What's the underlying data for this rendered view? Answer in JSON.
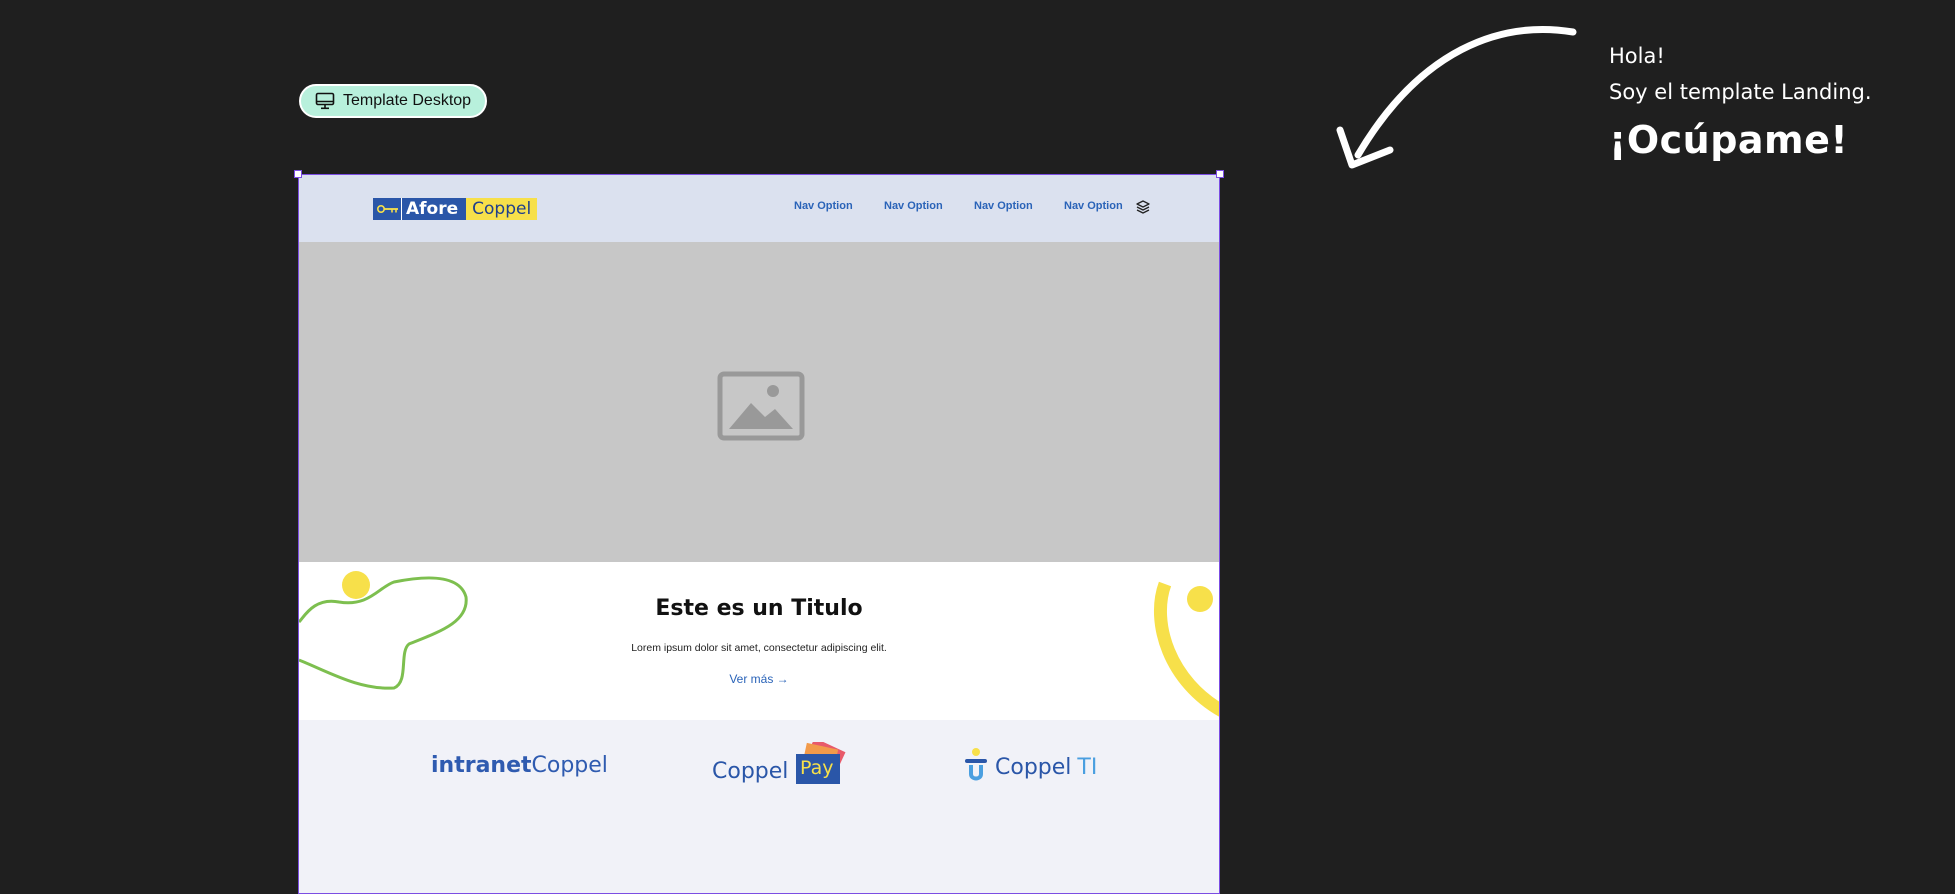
{
  "badge": {
    "label": "Template Desktop",
    "icon": "monitor-icon"
  },
  "note": {
    "line1": "Hola!",
    "line2": "Soy el template Landing.",
    "headline": "¡Ocúpame!"
  },
  "header": {
    "logo_left": "Afore",
    "logo_right": "Coppel",
    "nav": [
      "Nav Option",
      "Nav Option",
      "Nav Option",
      "Nav Option"
    ],
    "nav_icon": "layers-icon"
  },
  "hero": {
    "icon": "image-placeholder-icon"
  },
  "content": {
    "title": "Este es un Titulo",
    "body": "Lorem ipsum dolor sit amet, consectetur adipiscing elit.",
    "link": "Ver más"
  },
  "brands": {
    "intranet_bold": "intranet",
    "intranet_regular": "Coppel",
    "pay_word": "Coppel",
    "pay_badge": "Pay",
    "ti_word": "Coppel",
    "ti_suffix": "TI"
  },
  "colors": {
    "background": "#1f1f1f",
    "frame_border": "#7b4de3",
    "nav_bg": "#dbe1ef",
    "brand_blue": "#2a56a8",
    "brand_yellow": "#f7e04a",
    "accent_green": "#7dbf4f",
    "badge_bg": "#b8f0dc"
  }
}
